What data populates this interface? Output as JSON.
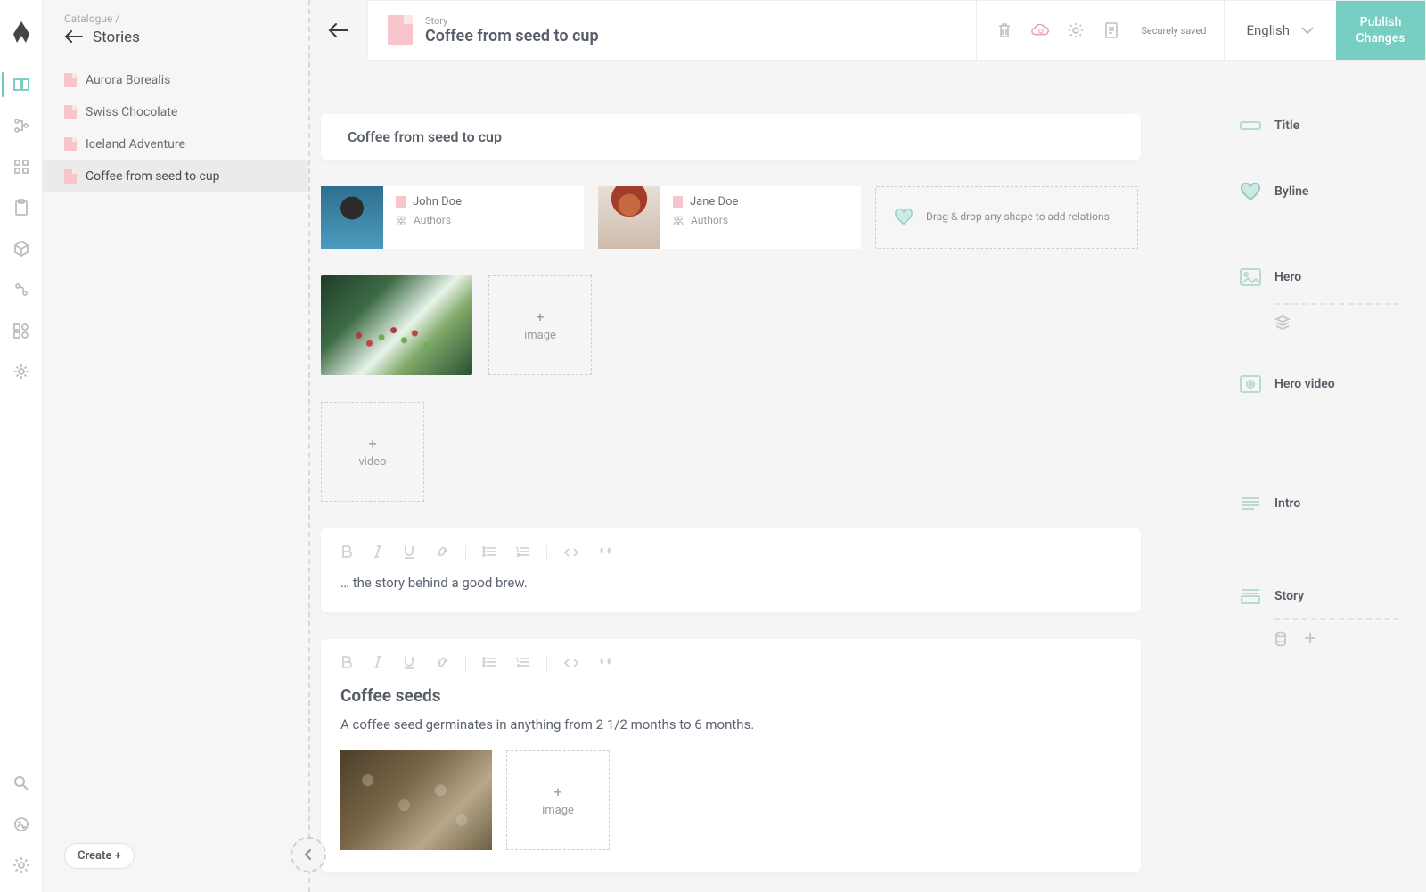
{
  "breadcrumb": {
    "root": "Catalogue",
    "sep": "/"
  },
  "sidebar": {
    "title": "Stories",
    "items": [
      {
        "label": "Aurora Borealis"
      },
      {
        "label": "Swiss Chocolate"
      },
      {
        "label": "Iceland Adventure"
      },
      {
        "label": "Coffee from seed to cup"
      }
    ],
    "create_label": "Create +"
  },
  "header": {
    "type_label": "Story",
    "title": "Coffee from seed to cup",
    "saved_label": "Securely saved",
    "language": "English",
    "publish_label": "Publish Changes"
  },
  "fields": {
    "title_label": "Title",
    "byline_label": "Byline",
    "hero_label": "Hero",
    "herovideo_label": "Hero video",
    "intro_label": "Intro",
    "story_label": "Story"
  },
  "content": {
    "title": "Coffee from seed to cup",
    "authors": [
      {
        "name": "John Doe",
        "role": "Authors"
      },
      {
        "name": "Jane Doe",
        "role": "Authors"
      }
    ],
    "relation_hint": "Drag & drop any shape to add relations",
    "upload_image_label": "image",
    "upload_video_label": "video",
    "plus": "+",
    "intro_text": "… the story behind a good brew.",
    "story_heading": "Coffee seeds",
    "story_text": "A coffee seed germinates in anything from 2 1/2 months to 6 months."
  }
}
